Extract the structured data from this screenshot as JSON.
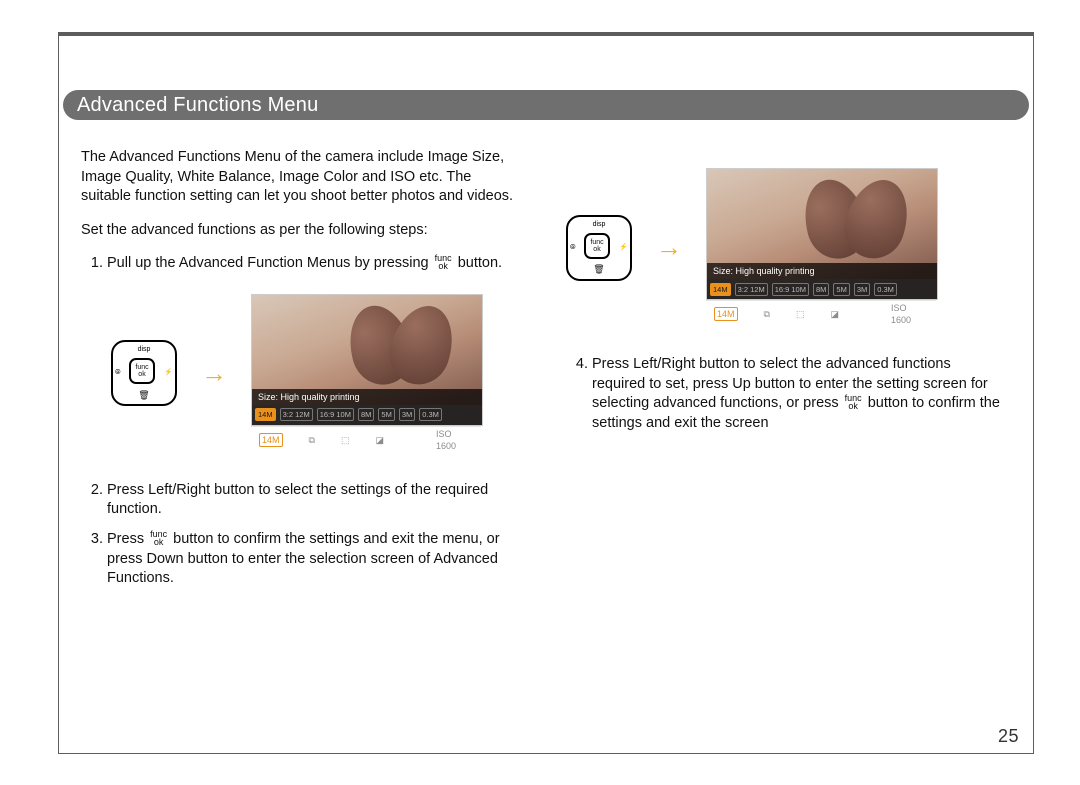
{
  "page_number": "25",
  "title": "Advanced Functions Menu",
  "intro": "The Advanced Functions Menu of the camera include Image Size, Image Quality, White Balance, Image Color and ISO etc. The suitable function setting can let you shoot better photos and videos.",
  "set_heading": "Set the advanced functions as per the following steps:",
  "step1_a": "Pull up the Advanced Function Menus by pressing ",
  "step1_b": " button.",
  "step2": "Press Left/Right button to select the settings of the required function.",
  "step3_a": "Press ",
  "step3_b": " button to confirm the settings and exit the menu, or press Down button to enter the selection screen of Advanced Functions.",
  "step4_a": "Press Left/Right button to select the advanced functions required to set, press Up button to enter the setting screen for selecting advanced functions, or press ",
  "step4_b": " button to confirm the settings and exit the screen",
  "func_label_top": "func",
  "func_label_bot": "ok",
  "pad": {
    "top": "disp",
    "left": "⦾",
    "right": "⚡",
    "trash": "🗑"
  },
  "lcd": {
    "caption": "Size: High quality printing",
    "options": [
      "14M",
      "3:2 12M",
      "16:9 10M",
      "8M",
      "5M",
      "3M",
      "0.3M"
    ],
    "selected_index": 0,
    "bottom_icons": [
      "14M",
      "⧉",
      "⬚",
      "◪",
      "ISO 1600"
    ]
  }
}
